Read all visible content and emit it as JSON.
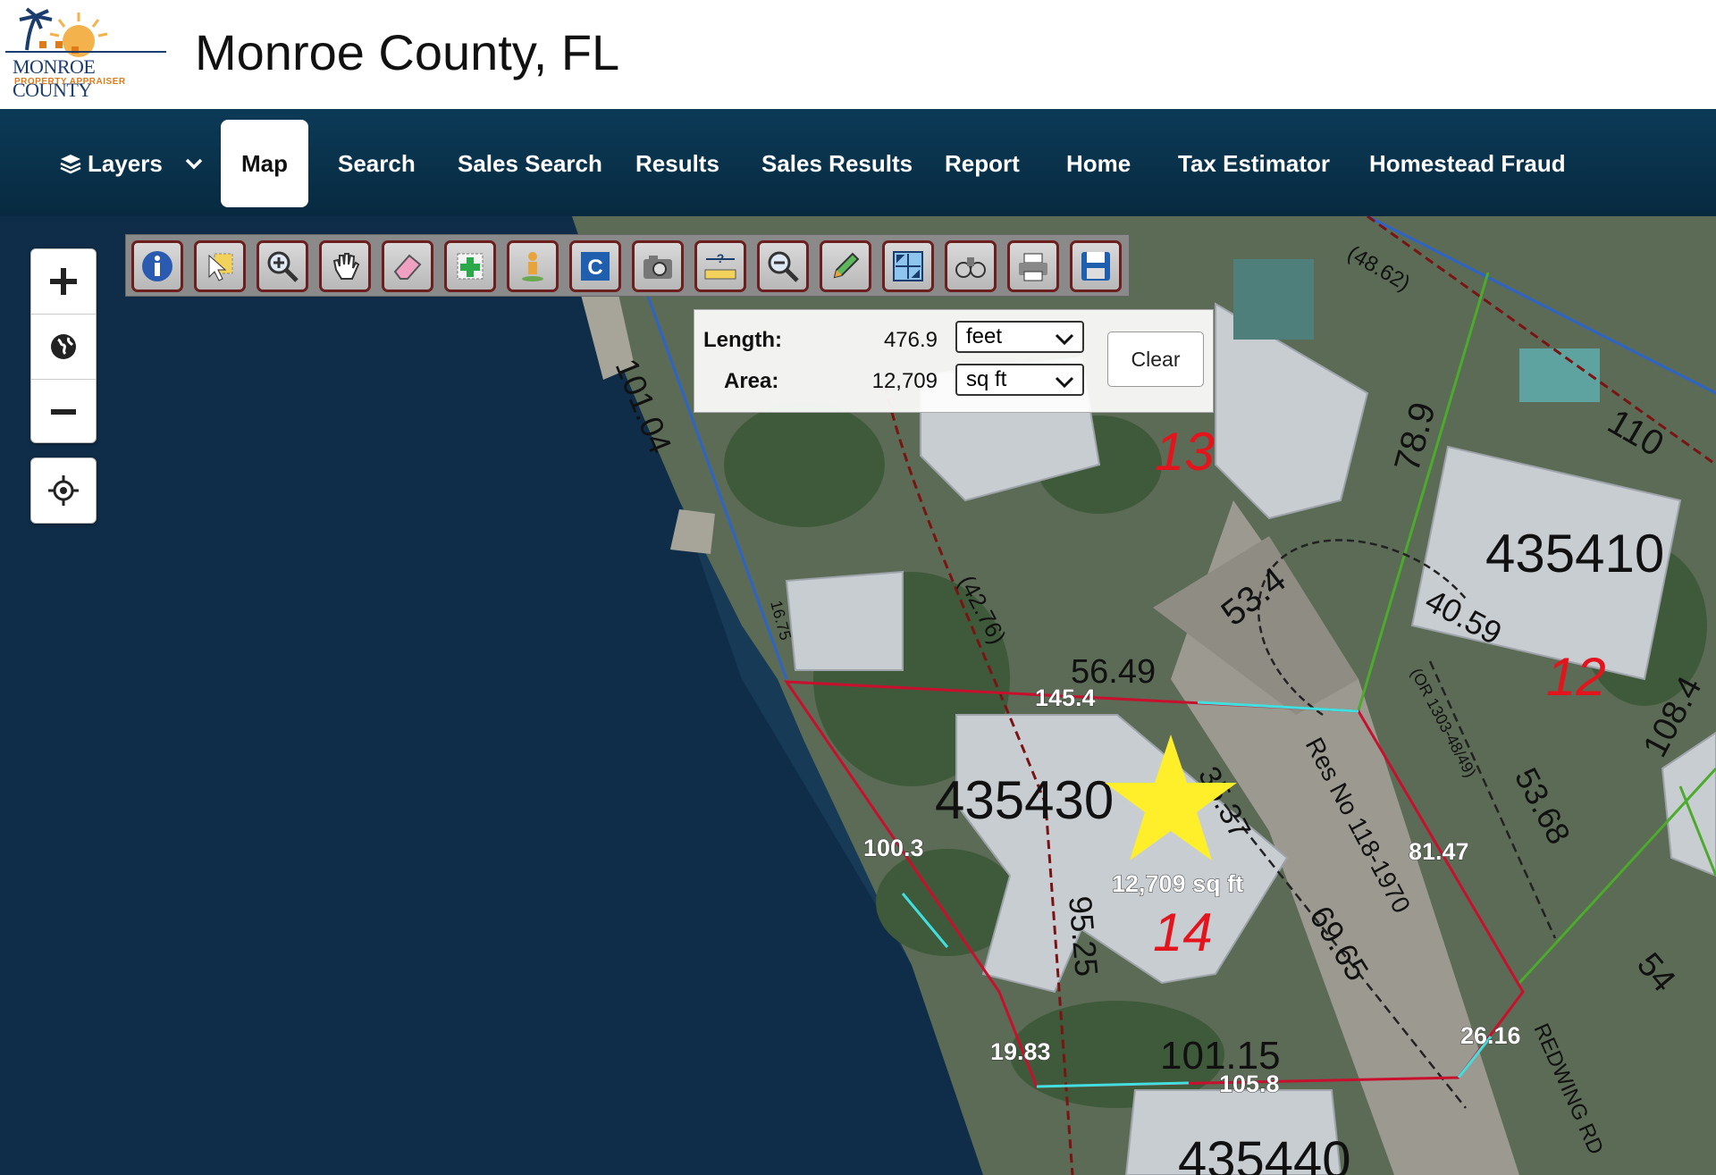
{
  "header": {
    "logo_line1": "MONROE COUNTY",
    "logo_line2": "PROPERTY APPRAISER",
    "title": "Monroe County, FL"
  },
  "nav": {
    "layers_label": "Layers",
    "items": [
      {
        "label": "Map",
        "active": true
      },
      {
        "label": "Search"
      },
      {
        "label": "Sales Search"
      },
      {
        "label": "Results"
      },
      {
        "label": "Sales Results"
      },
      {
        "label": "Report"
      },
      {
        "label": "Home"
      },
      {
        "label": "Tax Estimator"
      },
      {
        "label": "Homestead Fraud"
      }
    ]
  },
  "toolbar": {
    "tools": [
      "info-icon",
      "select-icon",
      "zoom-in-tool-icon",
      "pan-hand-icon",
      "eraser-icon",
      "add-selection-icon",
      "street-view-icon",
      "c-tool-icon",
      "camera-icon",
      "measure-icon",
      "zoom-out-tool-icon",
      "pencil-icon",
      "full-extent-icon",
      "binoculars-icon",
      "print-icon",
      "save-icon"
    ]
  },
  "measure": {
    "length_label": "Length:",
    "length_value": "476.9",
    "length_unit": "feet",
    "area_label": "Area:",
    "area_value": "12,709",
    "area_unit": "sq ft",
    "clear_label": "Clear"
  },
  "map": {
    "parcel_labels": [
      "435430",
      "435410",
      "435440"
    ],
    "lot_numbers": [
      "13",
      "14",
      "12"
    ],
    "segment_labels": [
      "145.4",
      "100.3",
      "81.47",
      "19.83",
      "105.8",
      "26.16"
    ],
    "area_label": "12,709 sq ft",
    "plat_dimensions": [
      "101.04",
      "(48.62)",
      "78.9",
      "110",
      "53.4",
      "(42.76)",
      "56.49",
      "40.59",
      "16.75",
      "35.37",
      "95.25",
      "69.65",
      "53.68",
      "101.15",
      "108.4",
      "54",
      "Res No 118-1970",
      "(OR 1303-48/49)",
      "REDWING RD"
    ]
  },
  "colors": {
    "nav_bg": "#0c3a57",
    "measure_line": "#c8102e",
    "measure_segment": "#40e0e0",
    "star": "#ffef2a"
  }
}
